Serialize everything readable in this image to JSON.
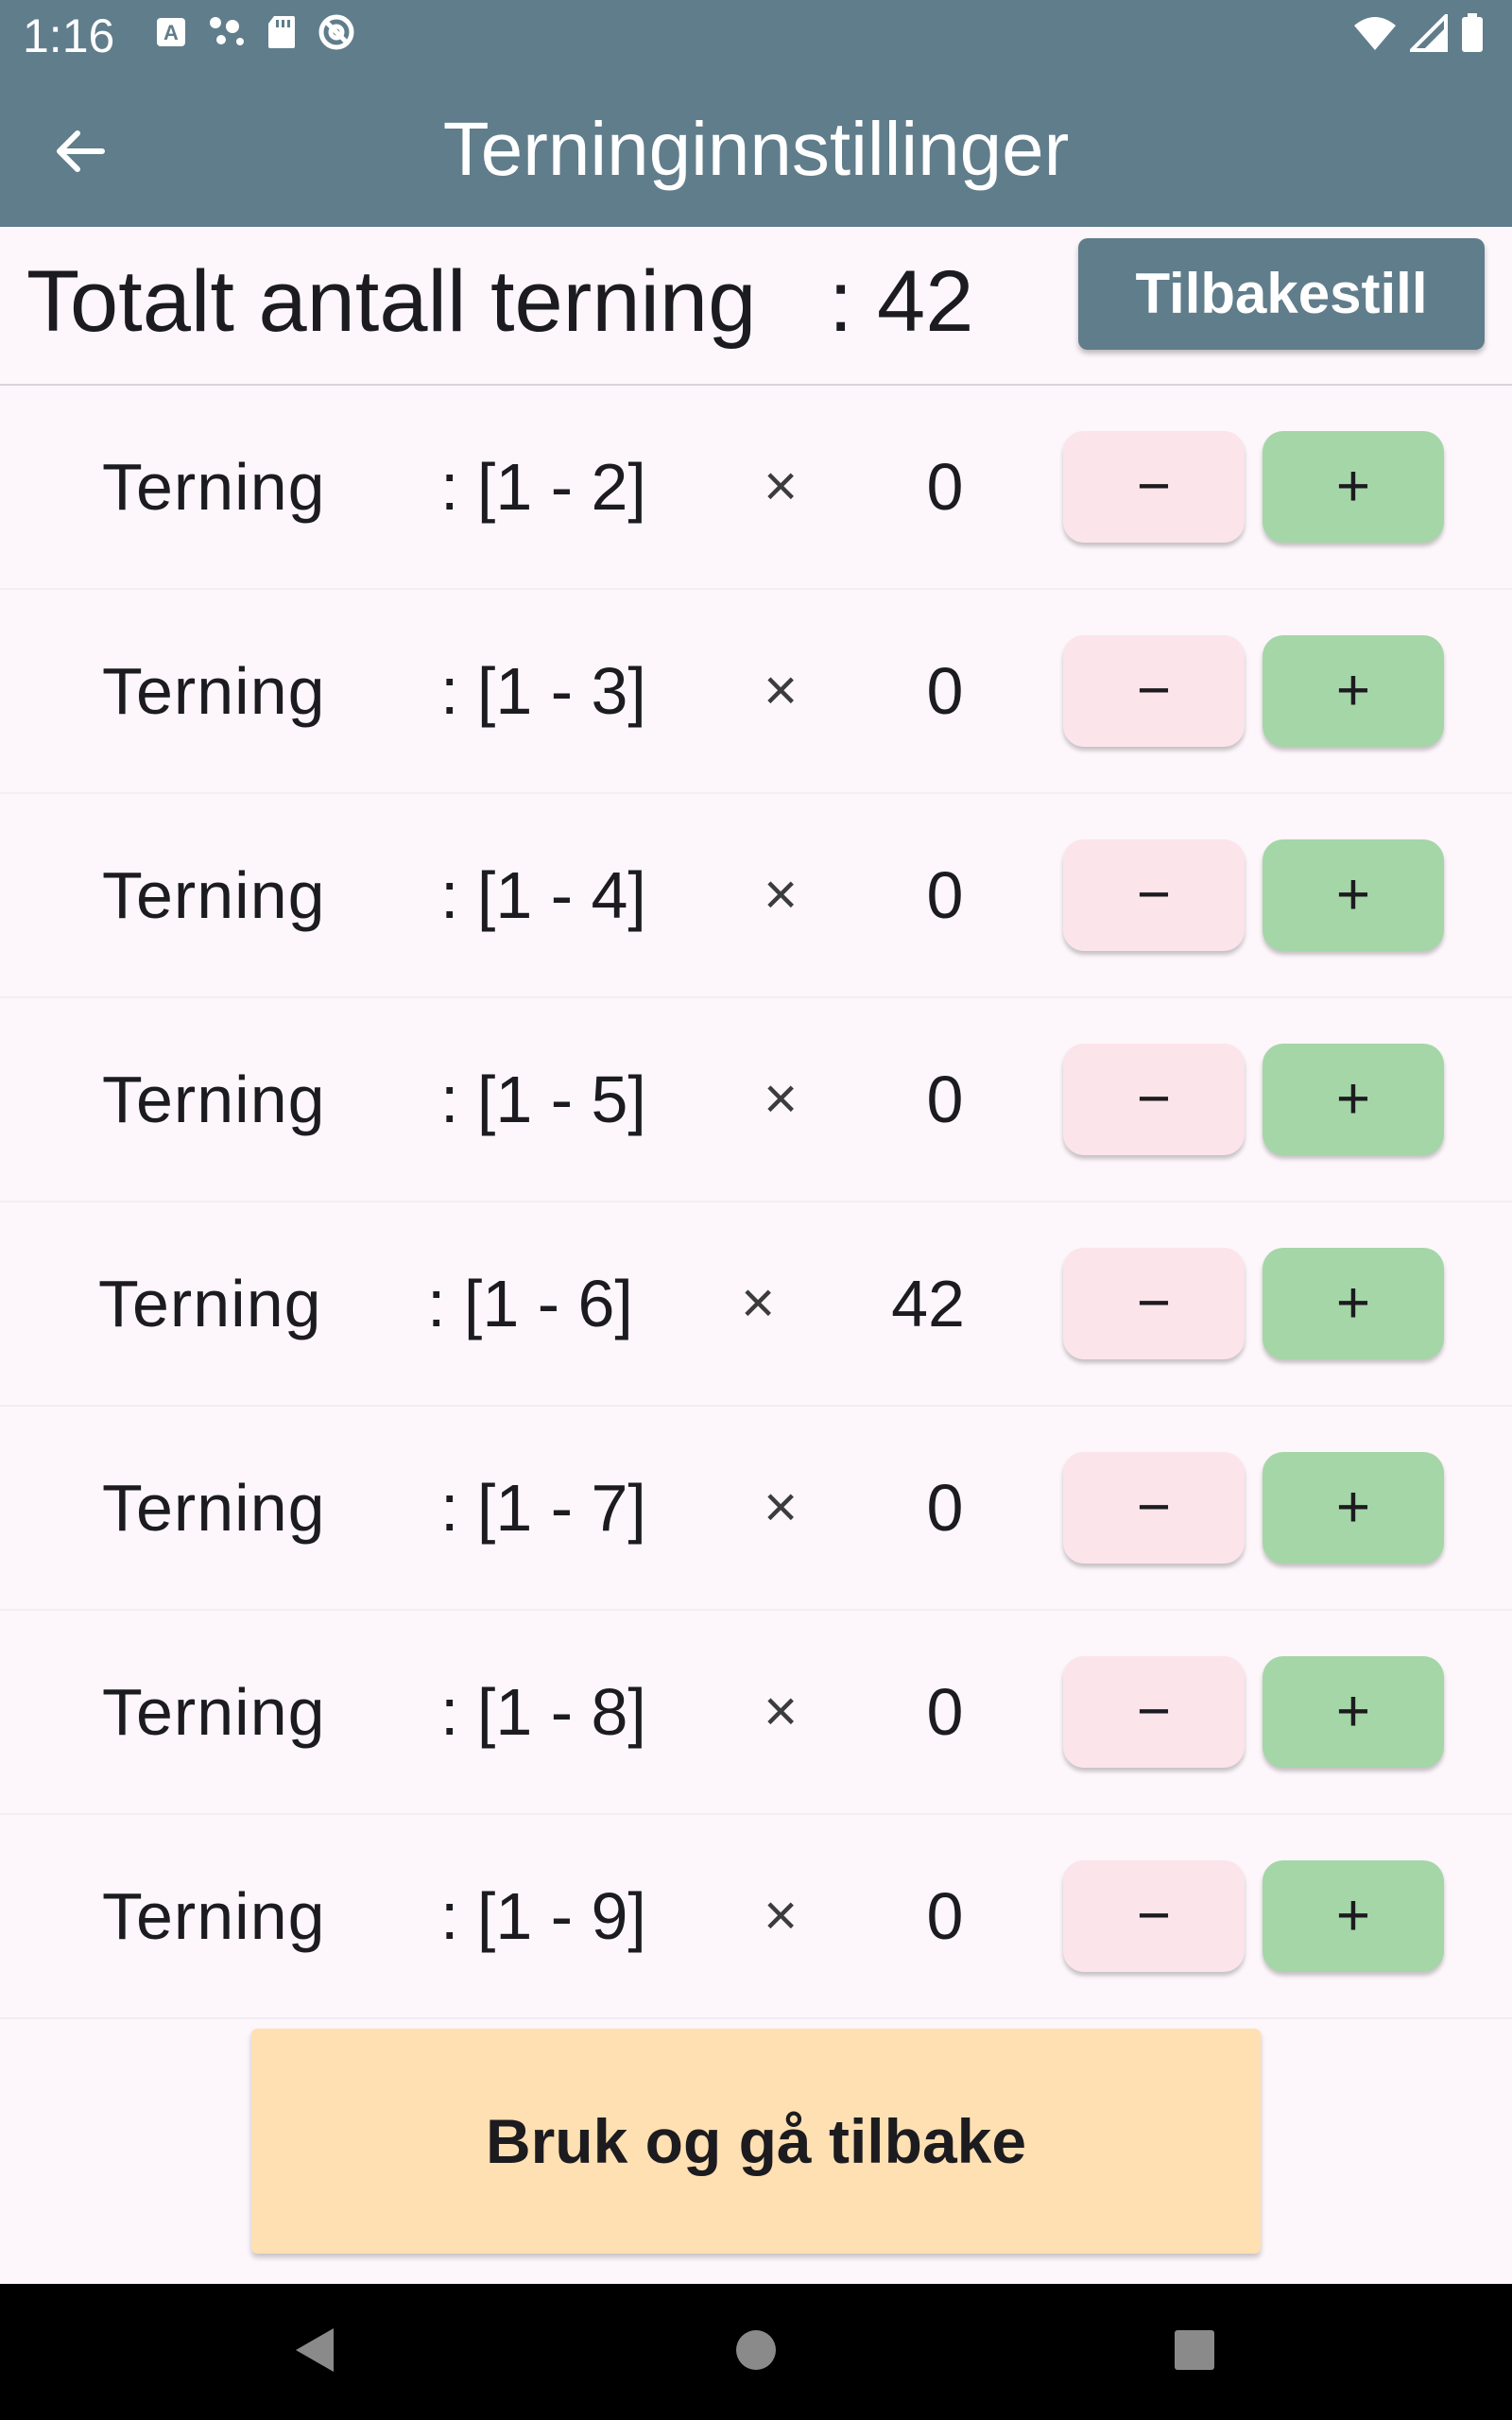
{
  "status_bar": {
    "time": "1:16",
    "left_icons": [
      "keyboard-a-icon",
      "assistant-dots-icon",
      "sd-card-icon",
      "at-sign-icon"
    ],
    "right_icons": [
      "wifi-icon",
      "cell-signal-icon",
      "battery-icon"
    ]
  },
  "app_bar": {
    "title": "Terninginnstillinger",
    "back_icon": "arrow-left-icon"
  },
  "header": {
    "total_label": "Totalt antall terning   : 42",
    "reset_label": "Tilbakestill"
  },
  "dice": [
    {
      "label": "Terning",
      "range": ": [1 - 2]",
      "times": "×",
      "count": "0",
      "minus": "−",
      "plus": "+"
    },
    {
      "label": "Terning",
      "range": ": [1 - 3]",
      "times": "×",
      "count": "0",
      "minus": "−",
      "plus": "+"
    },
    {
      "label": "Terning",
      "range": ": [1 - 4]",
      "times": "×",
      "count": "0",
      "minus": "−",
      "plus": "+"
    },
    {
      "label": "Terning",
      "range": ": [1 - 5]",
      "times": "×",
      "count": "0",
      "minus": "−",
      "plus": "+"
    },
    {
      "label": "Terning",
      "range": ": [1 - 6]",
      "times": "×",
      "count": "42",
      "minus": "−",
      "plus": "+"
    },
    {
      "label": "Terning",
      "range": ": [1 - 7]",
      "times": "×",
      "count": "0",
      "minus": "−",
      "plus": "+"
    },
    {
      "label": "Terning",
      "range": ": [1 - 8]",
      "times": "×",
      "count": "0",
      "minus": "−",
      "plus": "+"
    },
    {
      "label": "Terning",
      "range": ": [1 - 9]",
      "times": "×",
      "count": "0",
      "minus": "−",
      "plus": "+"
    }
  ],
  "apply_label": "Bruk og gå tilbake",
  "nav_bar": {
    "back_icon": "triangle-back-icon",
    "home_icon": "circle-home-icon",
    "recents_icon": "square-recents-icon"
  },
  "colors": {
    "app_bar": "#607d8b",
    "background": "#fdf7fb",
    "minus_button": "#fbe4ea",
    "plus_button": "#a5d6a7",
    "apply_button": "#ffe0b2"
  }
}
